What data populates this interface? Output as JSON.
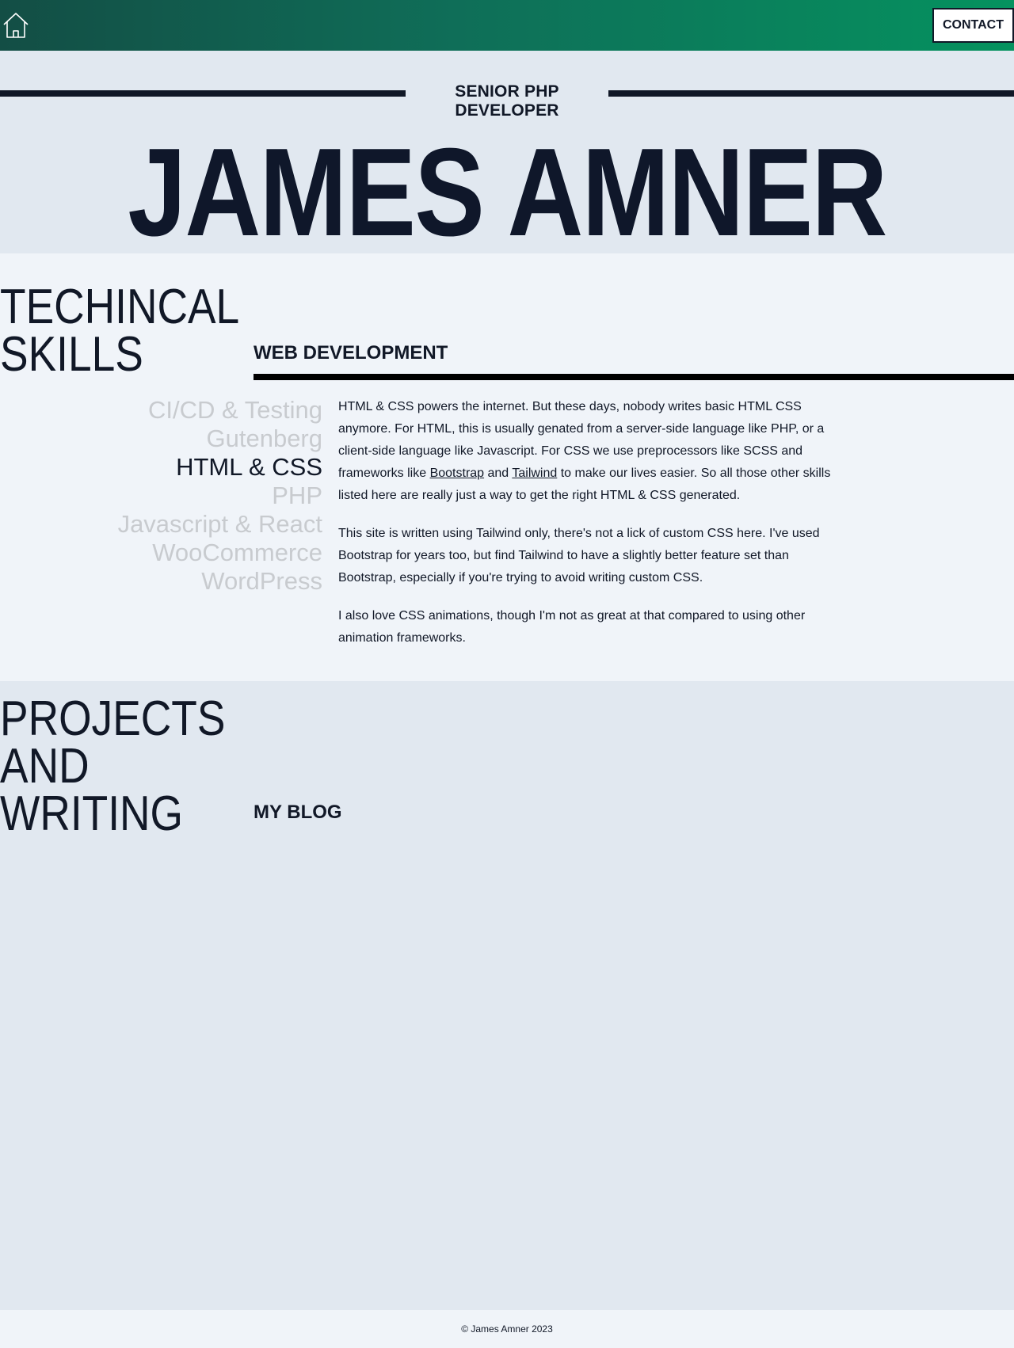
{
  "header": {
    "home_icon": "home-icon",
    "contact_label": "CONTACT",
    "gradient_colors": [
      "#134e45",
      "#05925f"
    ]
  },
  "hero": {
    "subtitle": "SENIOR PHP DEVELOPER",
    "name": "JAMES AMNER"
  },
  "skills": {
    "title_line1": "TECHINCAL",
    "title_line2": "SKILLS",
    "items": [
      {
        "label": "CI/CD & Testing",
        "active": false
      },
      {
        "label": "Gutenberg",
        "active": false
      },
      {
        "label": "HTML & CSS",
        "active": true
      },
      {
        "label": "PHP",
        "active": false
      },
      {
        "label": "Javascript & React",
        "active": false
      },
      {
        "label": "WooCommerce",
        "active": false
      },
      {
        "label": "WordPress",
        "active": false
      }
    ],
    "selected": {
      "heading": "WEB DEVELOPMENT",
      "p1_part1": "HTML & CSS powers the internet. But these days, nobody writes basic HTML CSS anymore. For HTML, this is usually genated from a server-side language like PHP, or a client-side language like Javascript. For CSS we use preprocessors like SCSS and frameworks like ",
      "link_bootstrap": "Bootstrap",
      "p1_part2": " and ",
      "link_tailwind": "Tailwind",
      "p1_part3": " to make our lives easier. So all those other skills listed here are really just a way to get the right HTML & CSS generated.",
      "p2": "This site is written using Tailwind only, there's not a lick of custom CSS here. I've used Bootstrap for years too, but find Tailwind to have a slightly better feature set than Bootstrap, especially if you're trying to avoid writing custom CSS.",
      "p3": "I also love CSS animations, though I'm not as great at that compared to using other animation frameworks."
    }
  },
  "projects": {
    "title_line1": "PROJECTS",
    "title_line2": "AND",
    "title_line3": "WRITING",
    "blog_heading": "MY BLOG"
  },
  "footer": {
    "copyright": "© James Amner 2023"
  }
}
